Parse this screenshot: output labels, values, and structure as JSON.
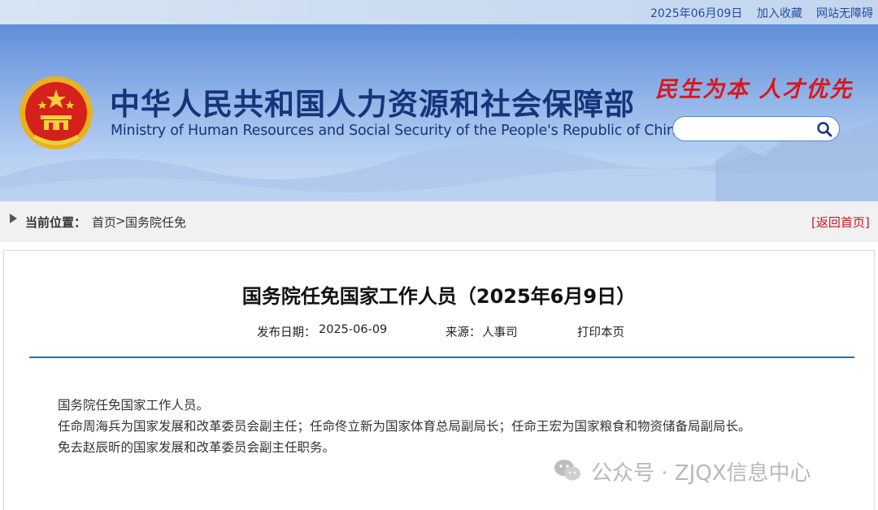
{
  "topbar": {
    "date": "2025年06月09日",
    "favorite": "加入收藏",
    "accessibility": "网站无障碍"
  },
  "header": {
    "cn_title": "中华人民共和国人力资源和社会保障部",
    "en_title": "Ministry of Human Resources and Social Security of the People's Republic of China",
    "slogan": "民生为本 人才优先",
    "search_placeholder": ""
  },
  "breadcrumb": {
    "label": "当前位置：",
    "home": "首页",
    "separator": ">",
    "category": "国务院任免",
    "back": "[返回首页]"
  },
  "article": {
    "title": "国务院任免国家工作人员（2025年6月9日）",
    "publish_label": "发布日期：",
    "publish_date": "2025-06-09",
    "source_label": "来源：",
    "source": "人事司",
    "print": "打印本页",
    "paragraphs": [
      "国务院任免国家工作人员。",
      "任命周海兵为国家发展和改革委员会副主任；任命佟立新为国家体育总局副局长；任命王宏为国家粮食和物资储备局副局长。",
      "免去赵辰昕的国家发展和改革委员会副主任职务。"
    ]
  },
  "watermark": {
    "text": "公众号 · ZJQX信息中心"
  },
  "colors": {
    "primary_blue": "#16347a",
    "slogan_red": "#d9171f",
    "rule_blue": "#2b6cb0",
    "link_red": "#c8161d"
  }
}
